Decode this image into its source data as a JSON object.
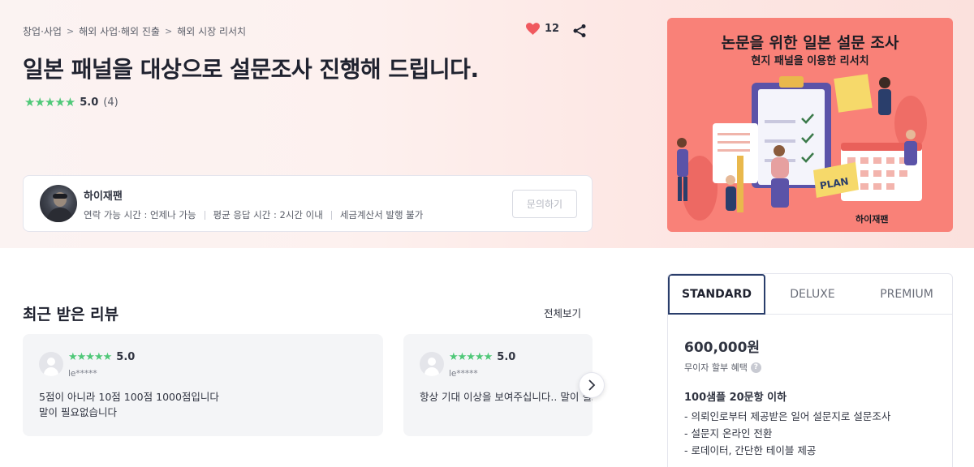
{
  "breadcrumb": [
    "창업·사업",
    "해외 사업·해외 진출",
    "해외 시장 리서치"
  ],
  "likes": {
    "count": "12",
    "icon": "heart-icon",
    "color": "#f0595f"
  },
  "share_icon": "share-icon",
  "gig": {
    "title": "일본 패널을 대상으로 설문조사 진행해 드립니다.",
    "rating": "5.0",
    "review_count": "(4)",
    "stars": "★★★★★",
    "star_color": "#4fc878"
  },
  "seller": {
    "name": "하이재팬",
    "contact_hours": "연락 가능 시간 : 언제나 가능",
    "avg_response": "평균 응답 시간 : 2시간 이내",
    "tax_invoice": "세금계산서 발행 불가",
    "inquiry_label": "문의하기"
  },
  "promo": {
    "title": "논문을 위한 일본 설문 조사",
    "subtitle": "현지 패널을 이용한 리서치",
    "plan_text": "PLAN",
    "brand": "하이재팬",
    "bg_color": "#f98178"
  },
  "reviews": {
    "section_title": "최근 받은 리뷰",
    "view_all": "전체보기",
    "items": [
      {
        "stars": "★★★★★",
        "score": "5.0",
        "user": "le*****",
        "line1": "5점이 아니라 10점 100점 1000점입니다",
        "line2": "말이 필요없습니다"
      },
      {
        "stars": "★★★★★",
        "score": "5.0",
        "user": "le*****",
        "line1": "항상 기대 이상을 보여주십니다.. 말이 필요",
        "line2": ""
      }
    ],
    "next_icon": "chevron-right-icon"
  },
  "packages": {
    "tabs": [
      "STANDARD",
      "DELUXE",
      "PREMIUM"
    ],
    "active_tab": "STANDARD",
    "price": "600,000원",
    "installment": "무이자 할부 혜택",
    "headline": "100샘플 20문항 이하",
    "features": [
      "- 의뢰인로부터 제공받은 일어 설문지로 설문조사",
      "- 설문지 온라인 전환",
      "- 로데이터, 간단한 테이블 제공"
    ],
    "accent_color": "#2a3e6b"
  }
}
